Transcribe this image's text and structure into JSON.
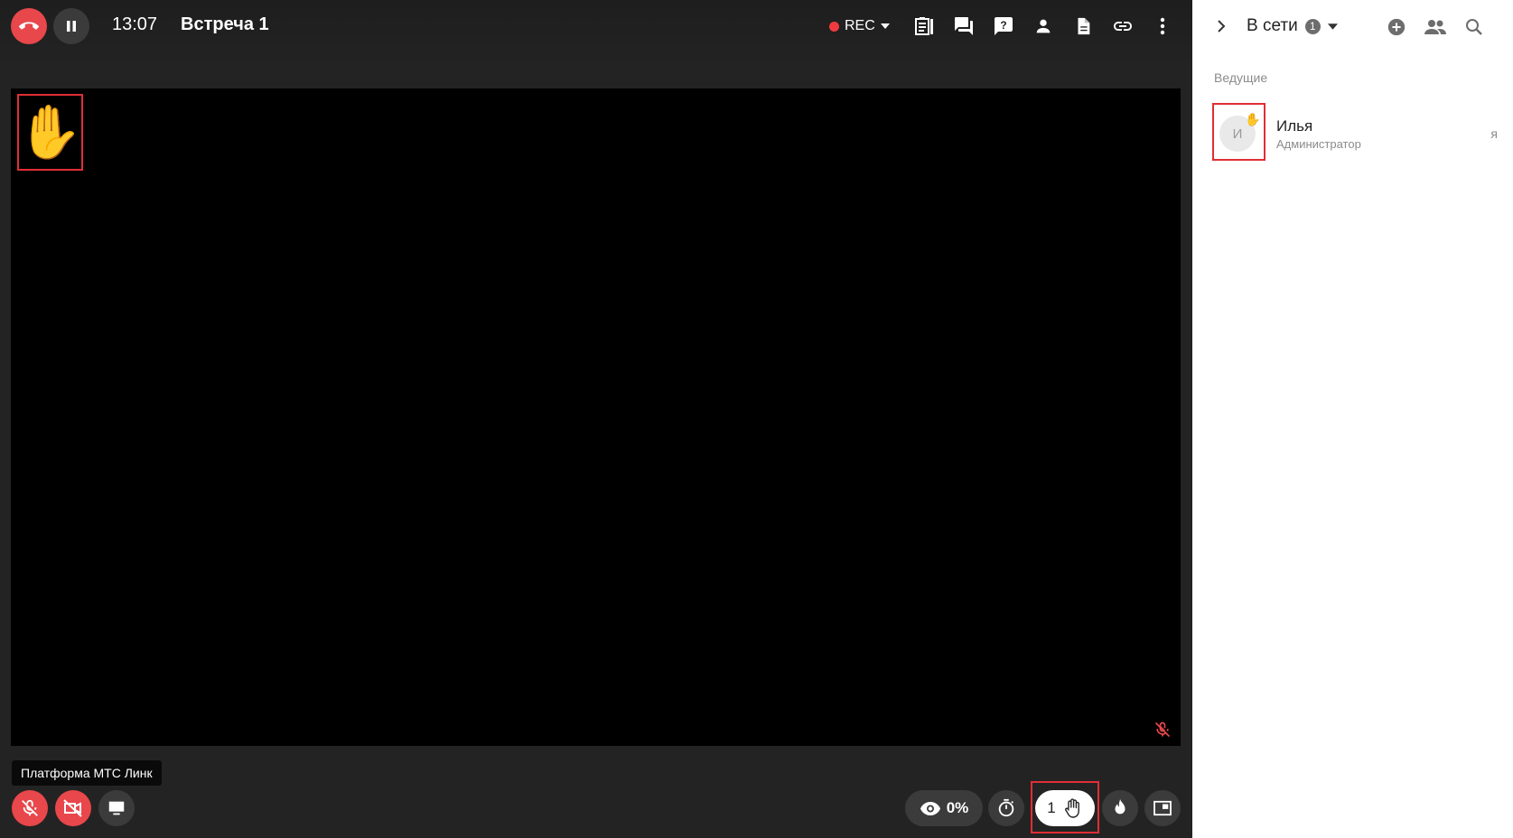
{
  "header": {
    "time": "13:07",
    "title": "Встреча 1",
    "rec_label": "REC",
    "icons": [
      "end-call-icon",
      "pause-icon",
      "record-dot-icon",
      "dropdown-icon",
      "notes-icon",
      "chat-icon",
      "questions-icon",
      "participant-icon",
      "file-icon",
      "link-icon",
      "more-vertical-icon"
    ]
  },
  "video": {
    "hand_emoji": "✋"
  },
  "footer": {
    "platform_label": "Платформа МТС Линк",
    "viewers_percent": "0%",
    "raised_hands_count": "1"
  },
  "sidebar": {
    "title": "В сети",
    "online_count": "1",
    "section_label": "Ведущие",
    "participants": [
      {
        "initial": "И",
        "name": "Илья",
        "role": "Администратор",
        "me_label": "я",
        "hand_raised": true,
        "hand_emoji": "✋"
      }
    ]
  },
  "colors": {
    "accent_red": "#e8474b",
    "highlight_border": "#e02e35",
    "main_bg": "#232323"
  }
}
